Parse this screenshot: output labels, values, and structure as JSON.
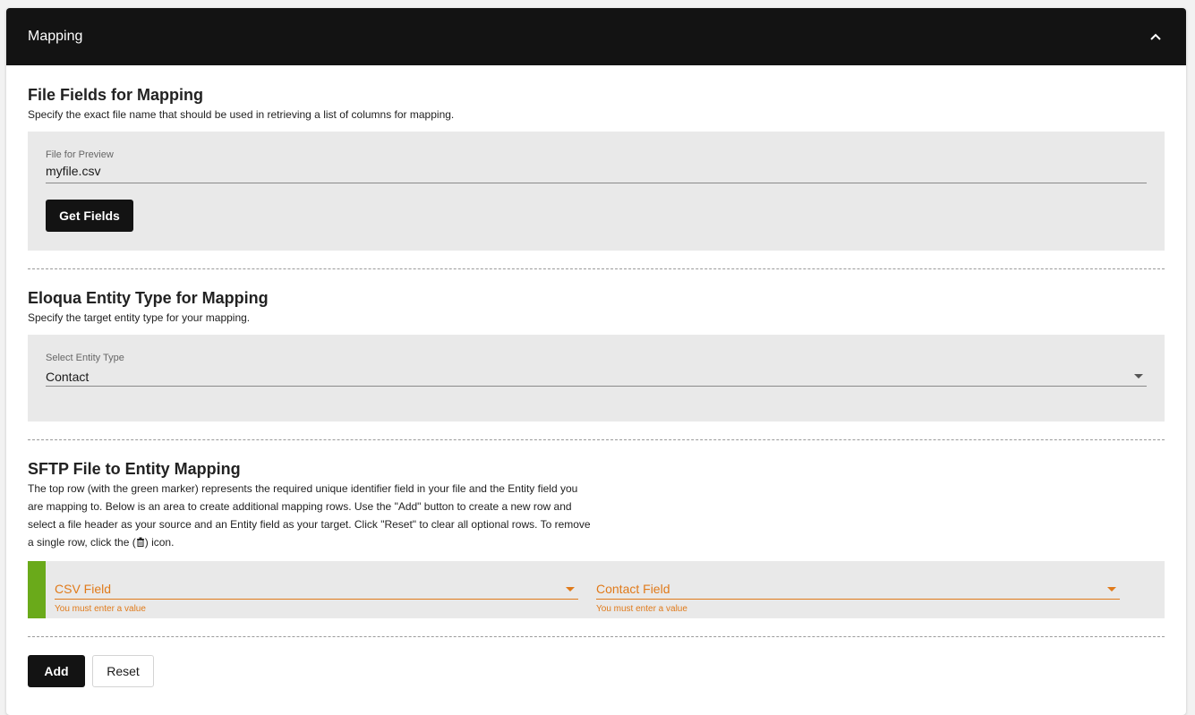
{
  "header": {
    "title": "Mapping"
  },
  "file_fields": {
    "title": "File Fields for Mapping",
    "description": "Specify the exact file name that should be used in retrieving a list of columns for mapping.",
    "input_label": "File for Preview",
    "input_value": "myfile.csv",
    "button_label": "Get Fields"
  },
  "entity_type": {
    "title": "Eloqua Entity Type for Mapping",
    "description": "Specify the target entity type for your mapping.",
    "select_label": "Select Entity Type",
    "select_value": "Contact"
  },
  "sftp_mapping": {
    "title": "SFTP File to Entity Mapping",
    "description_lines": [
      "The top row (with the green marker) represents the required unique identifier field in your file and the Entity field you",
      "are mapping to. Below is an area to create additional mapping rows. Use the \"Add\" button to create a new row and",
      "select a file header as your source and an Entity field as your target. Click \"Reset\" to clear all optional rows. To remove",
      "a single row, click the",
      "icon."
    ],
    "csv_field_placeholder": "CSV Field",
    "contact_field_placeholder": "Contact Field",
    "error_text": "You must enter a value"
  },
  "actions": {
    "add_label": "Add",
    "reset_label": "Reset"
  },
  "colors": {
    "header_bg": "#131313",
    "marker_green": "#6aaa1a",
    "error_orange": "#e07a1a"
  }
}
